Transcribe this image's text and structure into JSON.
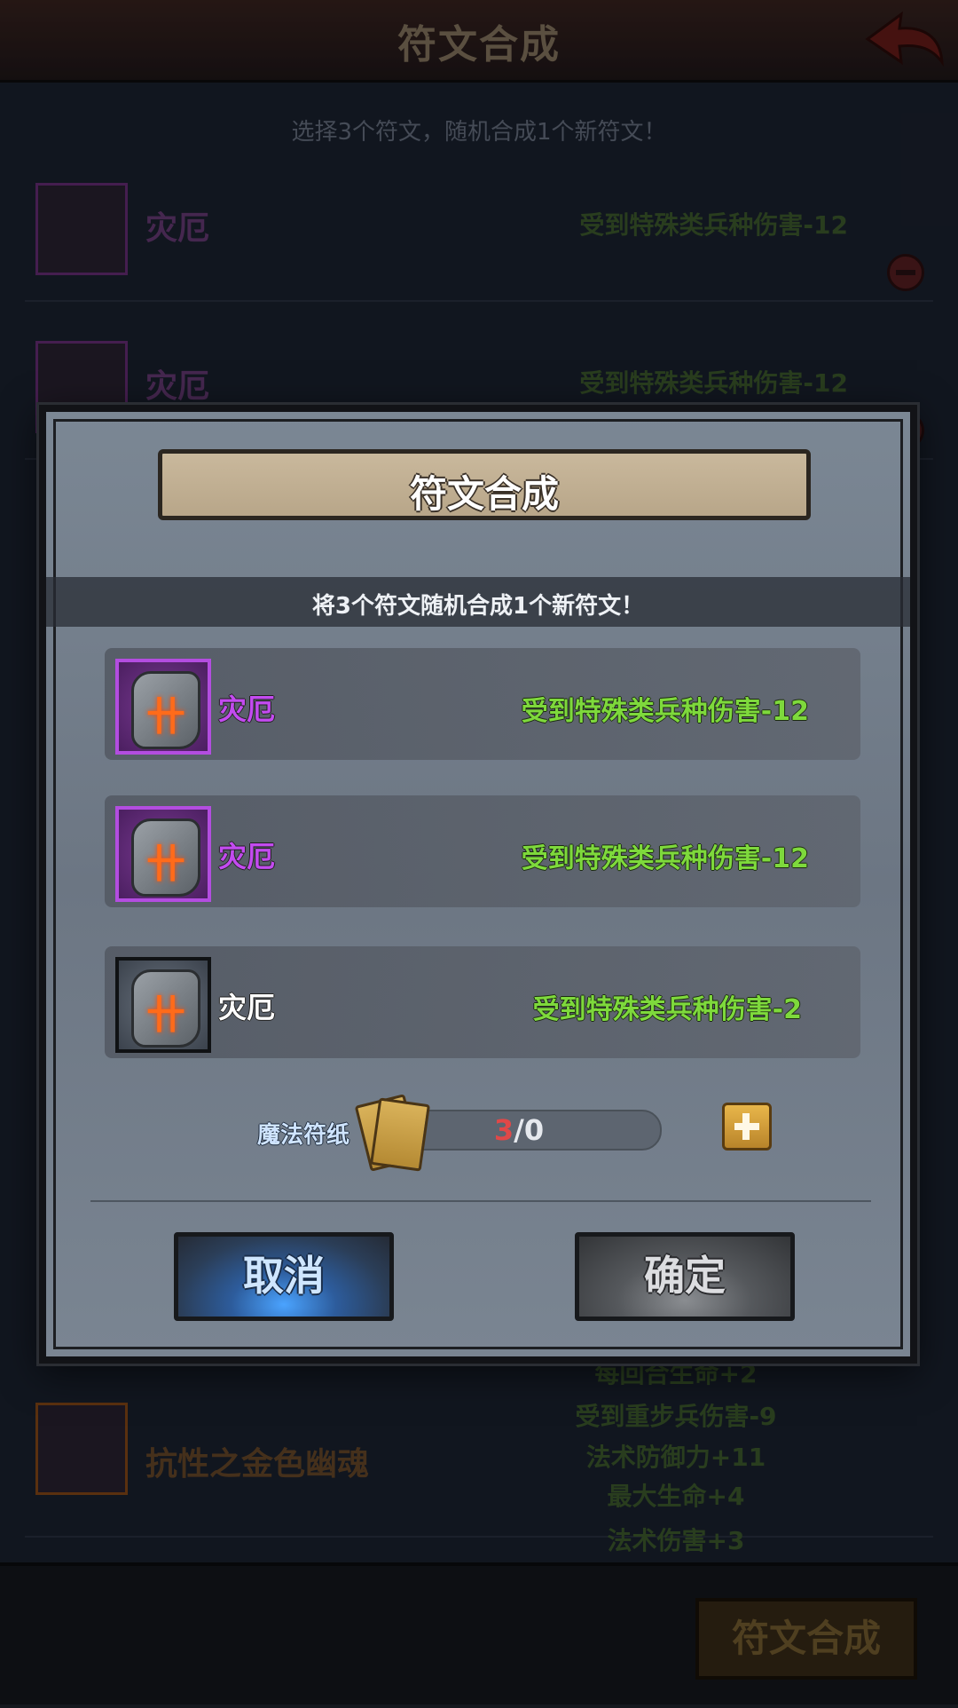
{
  "background": {
    "title": "符文合成",
    "subtitle": "选择3个符文，随机合成1个新符文！",
    "rows": [
      {
        "name": "灾厄",
        "effect": "受到特殊类兵种伤害-12"
      },
      {
        "name": "灾厄",
        "effect": "受到特殊类兵种伤害-12"
      }
    ],
    "bottom_row": {
      "name": "抗性之金色幽魂",
      "partial_top_effect": "每回合生命+2",
      "effects": [
        "受到重步兵伤害-9",
        "法术防御力+11",
        "最大生命+4",
        "法术伤害+3"
      ]
    },
    "compose_button": "符文合成"
  },
  "dialog": {
    "title": "符文合成",
    "info": "将3个符文随机合成1个新符文！",
    "runes": [
      {
        "name": "灾厄",
        "effect": "受到特殊类兵种伤害-12",
        "rarity_color": "#b34de0"
      },
      {
        "name": "灾厄",
        "effect": "受到特殊类兵种伤害-12",
        "rarity_color": "#b34de0"
      },
      {
        "name": "灾厄",
        "effect": "受到特殊类兵种伤害-2",
        "rarity_color": "#101214"
      }
    ],
    "material": {
      "label": "魔法符纸",
      "have": "3",
      "separator": "/",
      "need": "0"
    },
    "cancel_label": "取消",
    "confirm_label": "确定"
  },
  "icons": {
    "rune_glyph": "卄",
    "back": "back-arrow-icon",
    "add": "plus-icon",
    "remove": "minus-icon",
    "paper": "magic-paper-icon"
  }
}
